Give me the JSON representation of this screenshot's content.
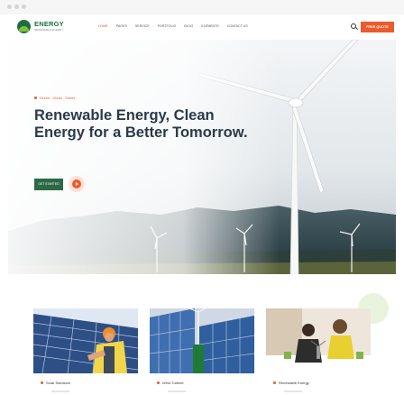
{
  "header": {
    "logo_name": "ENERGY",
    "logo_tagline": "RENEWABLE ENERGY",
    "nav": [
      "Home",
      "Pages",
      "Service",
      "Portfolio",
      "Blog",
      "Elements",
      "Contact Us"
    ],
    "quote_button": "Free Quote"
  },
  "hero": {
    "eyebrow": "Green , Clean , Smart",
    "title": "Renewable Energy, Clean Energy for a Better Tomorrow.",
    "button": "Get Started",
    "accent_color": "#ec5b2b",
    "primary_color": "#2c6a45"
  },
  "services": [
    {
      "label": "Solar Solutions"
    },
    {
      "label": "Wind Turbine"
    },
    {
      "label": "Renewable Energy"
    }
  ]
}
